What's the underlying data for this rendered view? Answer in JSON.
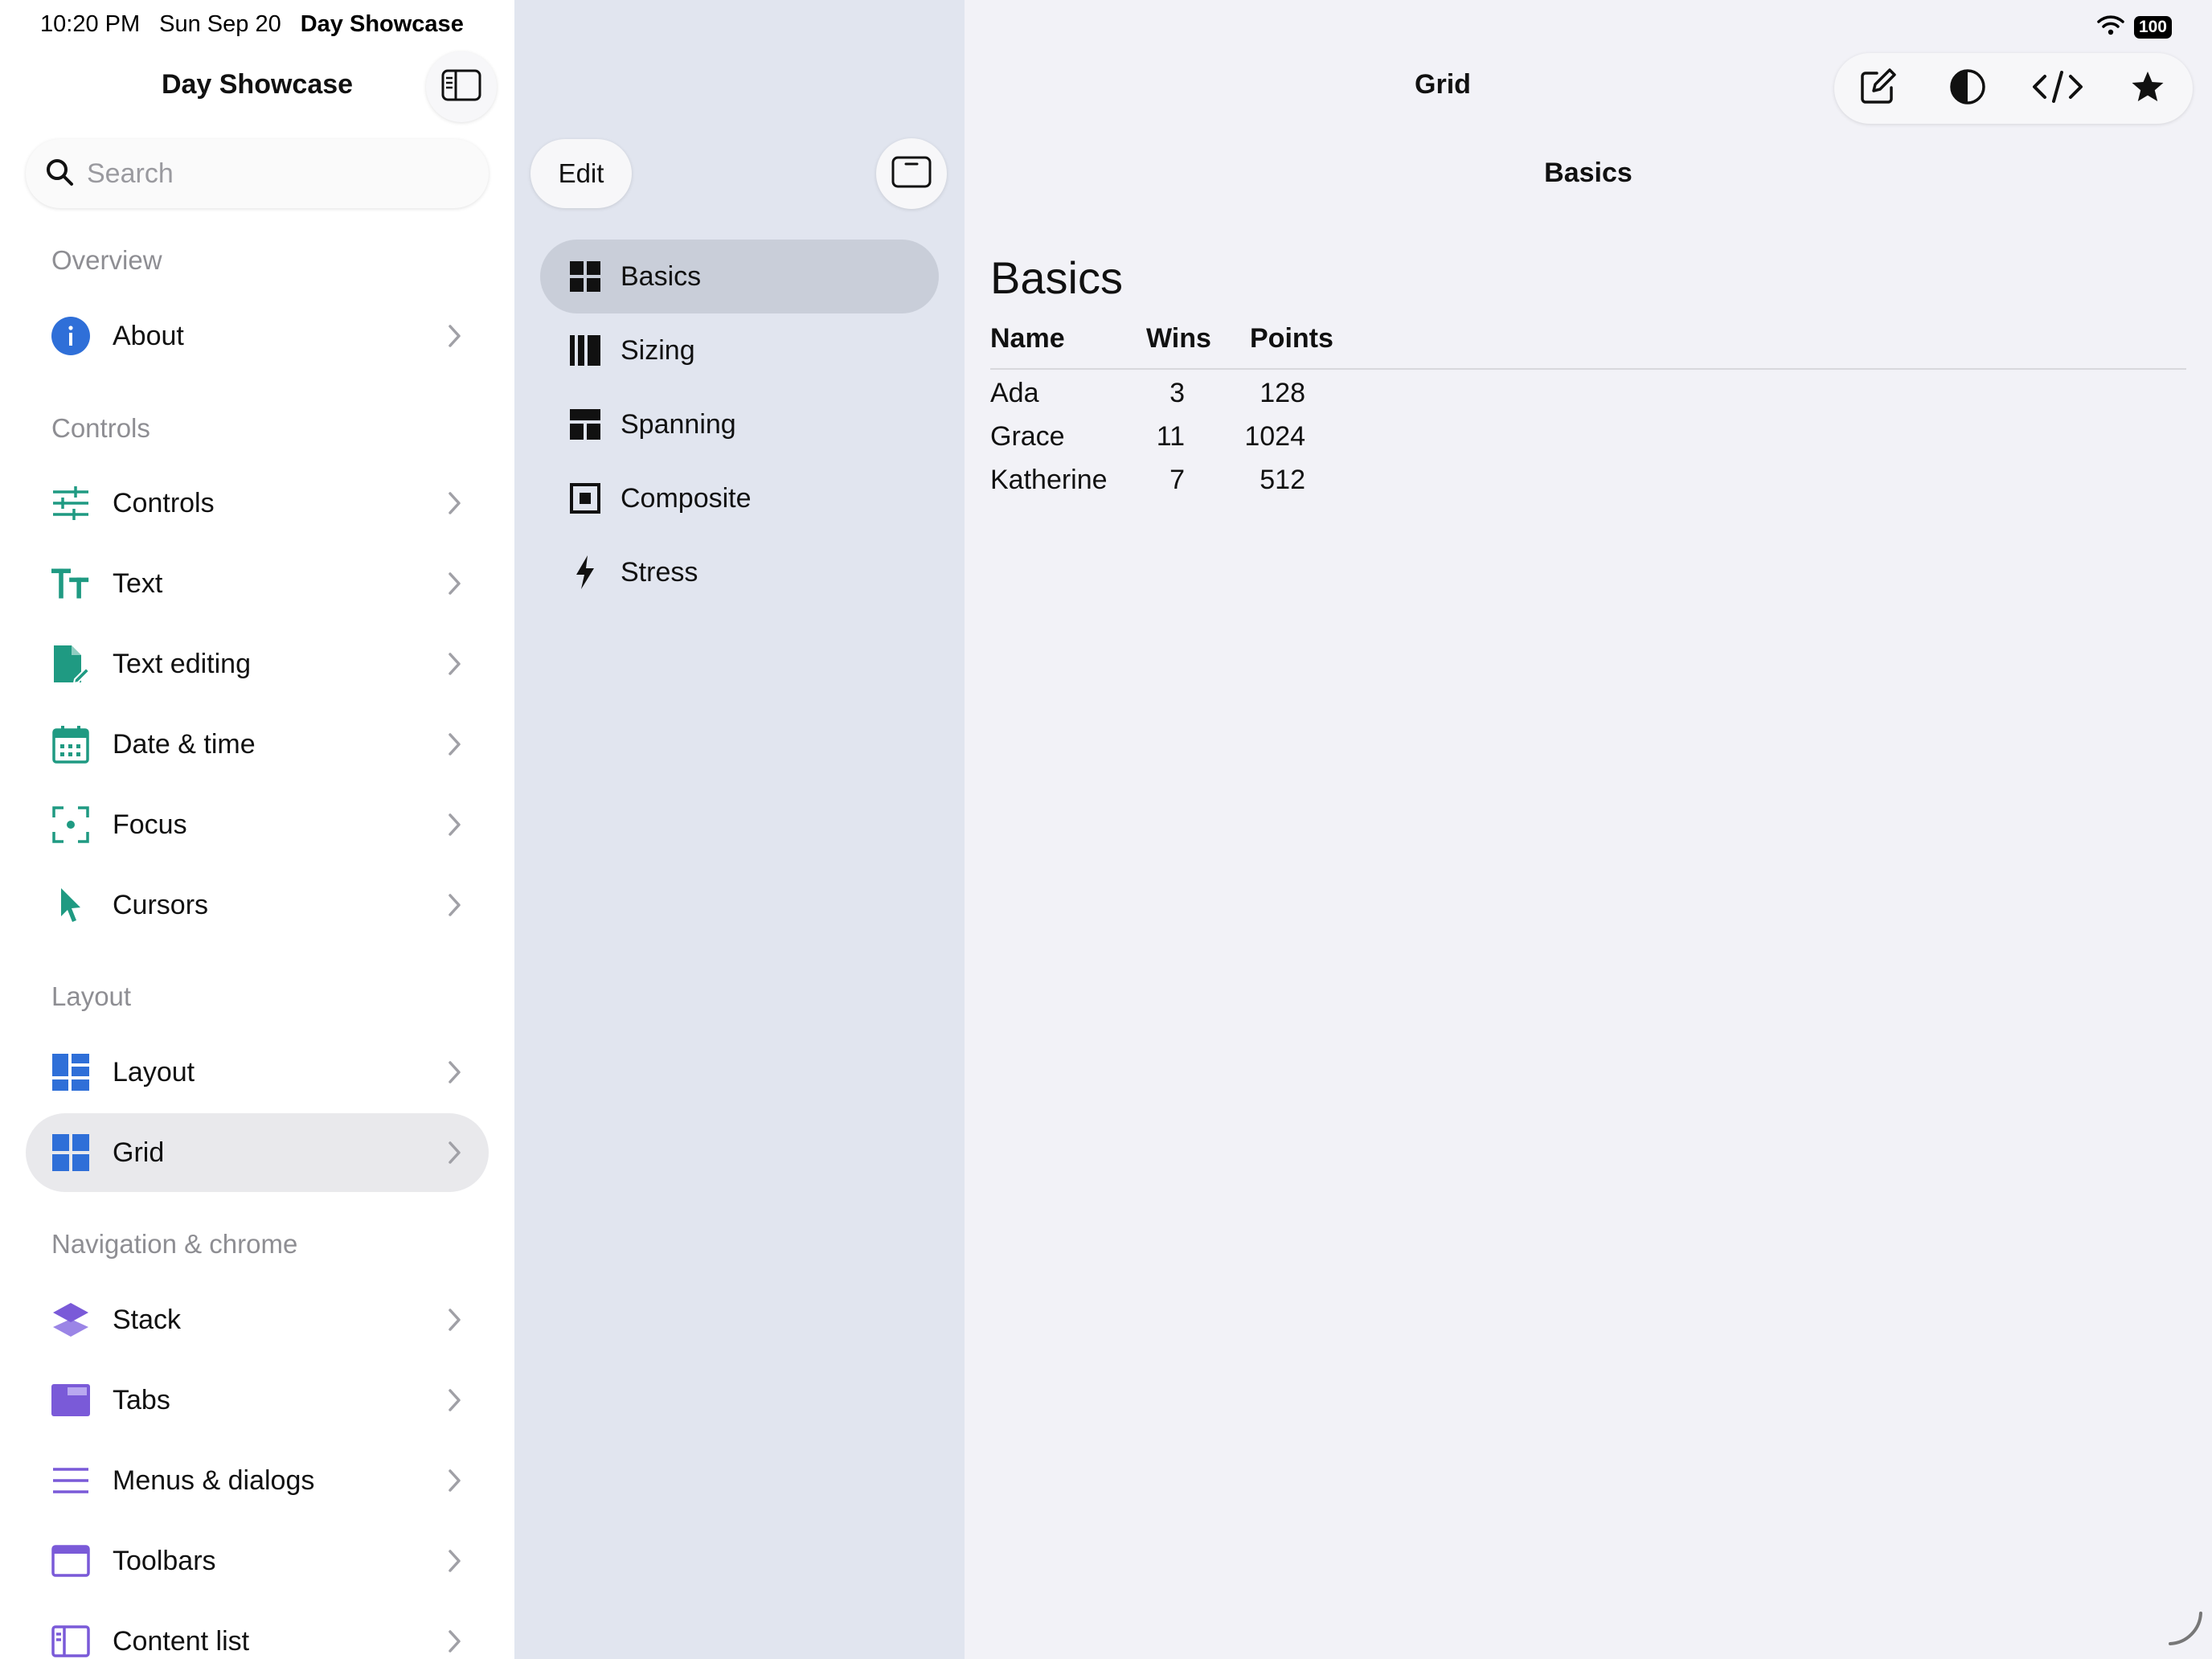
{
  "status_bar": {
    "time": "10:20 PM",
    "date": "Sun Sep 20",
    "app": "Day Showcase",
    "battery": "100"
  },
  "sidebar": {
    "title": "Day Showcase",
    "search_placeholder": "Search",
    "sections": [
      {
        "header": "Overview",
        "items": [
          {
            "label": "About",
            "icon": "info-icon"
          }
        ]
      },
      {
        "header": "Controls",
        "items": [
          {
            "label": "Controls",
            "icon": "sliders-icon"
          },
          {
            "label": "Text",
            "icon": "text-size-icon"
          },
          {
            "label": "Text editing",
            "icon": "doc-edit-icon"
          },
          {
            "label": "Date & time",
            "icon": "calendar-icon"
          },
          {
            "label": "Focus",
            "icon": "focus-icon"
          },
          {
            "label": "Cursors",
            "icon": "cursor-icon"
          }
        ]
      },
      {
        "header": "Layout",
        "items": [
          {
            "label": "Layout",
            "icon": "layout-icon"
          },
          {
            "label": "Grid",
            "icon": "grid-icon",
            "selected": true
          }
        ]
      },
      {
        "header": "Navigation & chrome",
        "items": [
          {
            "label": "Stack",
            "icon": "stack-icon"
          },
          {
            "label": "Tabs",
            "icon": "tabs-icon"
          },
          {
            "label": "Menus & dialogs",
            "icon": "menu-icon"
          },
          {
            "label": "Toolbars",
            "icon": "toolbar-icon"
          },
          {
            "label": "Content list",
            "icon": "content-list-icon"
          }
        ]
      }
    ]
  },
  "middle": {
    "edit_label": "Edit",
    "items": [
      {
        "label": "Basics",
        "icon": "grid-icon",
        "selected": true
      },
      {
        "label": "Sizing",
        "icon": "columns-icon"
      },
      {
        "label": "Spanning",
        "icon": "spanning-icon"
      },
      {
        "label": "Composite",
        "icon": "composite-icon"
      },
      {
        "label": "Stress",
        "icon": "bolt-icon"
      }
    ]
  },
  "detail": {
    "title": "Grid",
    "subtitle": "Basics",
    "heading": "Basics",
    "toolbar": [
      "compose-icon",
      "contrast-icon",
      "code-icon",
      "star-icon"
    ],
    "grid": {
      "headers": [
        "Name",
        "Wins",
        "Points"
      ],
      "rows": [
        [
          "Ada",
          "3",
          "128"
        ],
        [
          "Grace",
          "11",
          "1024"
        ],
        [
          "Katherine",
          "7",
          "512"
        ]
      ]
    }
  },
  "colors": {
    "accent_blue": "#2f6fd8",
    "teal": "#1f9a82",
    "purple": "#7a5ad8",
    "selected_sidebar": "#e9e9ec",
    "selected_middle": "#c9ced9"
  }
}
